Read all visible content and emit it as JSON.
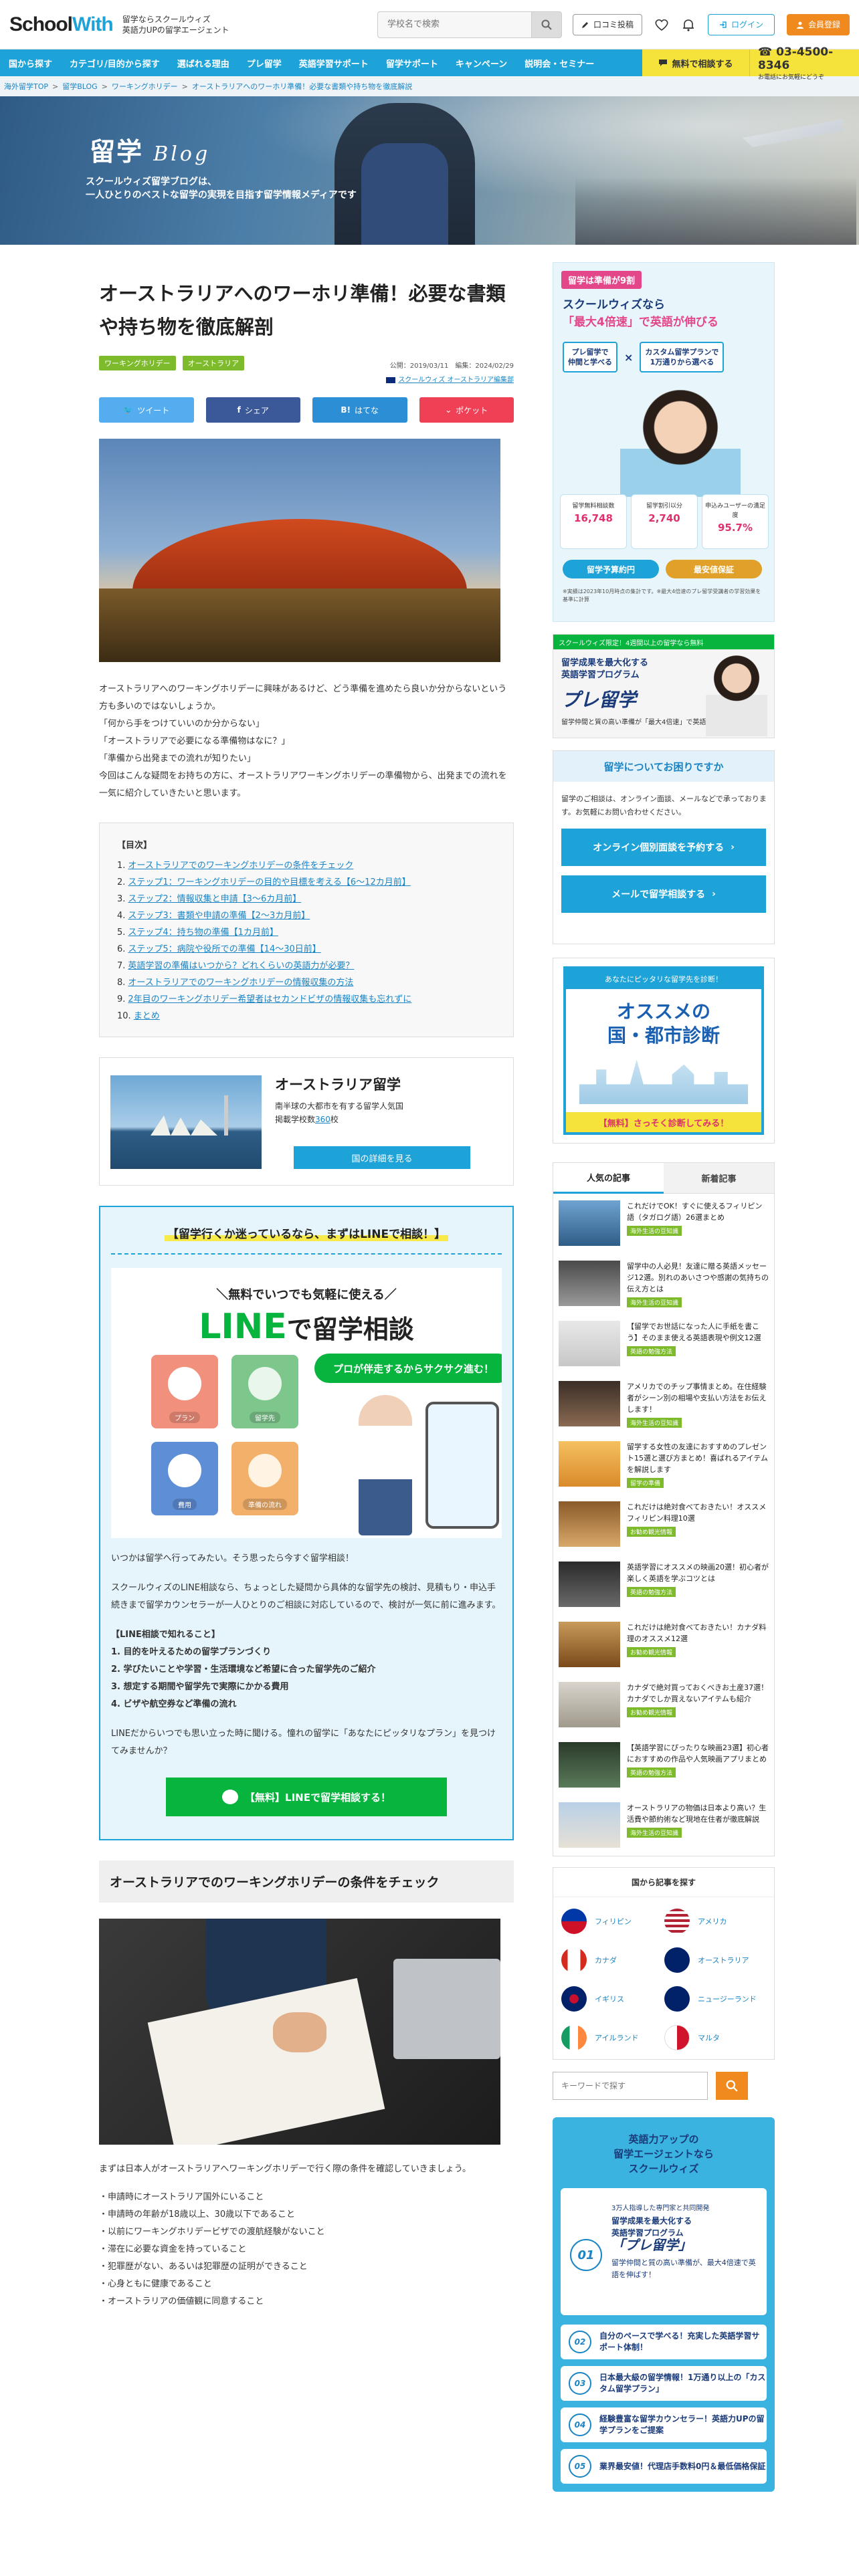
{
  "header": {
    "logo_school": "School",
    "logo_with": "With",
    "tagline_1": "留学ならスクールウィズ",
    "tagline_2": "英語力UPの留学エージェント",
    "search_placeholder": "学校名で検索",
    "review_label": "口コミ投稿",
    "login_label": "ログイン",
    "signup_label": "会員登録"
  },
  "nav": {
    "items": [
      "国から探す",
      "カテゴリ/目的から探す",
      "選ばれる理由",
      "プレ留学",
      "英語学習サポート",
      "留学サポート",
      "キャンペーン",
      "説明会・セミナー"
    ],
    "cta_label": "無料で相談する",
    "tel": "03-4500-8346",
    "tel_sub": "お電話にお気軽にどうぞ"
  },
  "breadcrumb": [
    "海外留学TOP",
    "留学BLOG",
    "ワーキングホリデー",
    "オーストラリアへのワーホリ準備！必要な書類や持ち物を徹底解説"
  ],
  "hero": {
    "title": "留学",
    "title_script": "Blog",
    "desc_1": "スクールウィズ留学ブログは、",
    "desc_2": "一人ひとりのベストな留学の実現を目指す留学情報メディアです"
  },
  "article": {
    "title": "オーストラリアへのワーホリ準備！必要な書類や持ち物を徹底解剖",
    "tags": [
      "ワーキングホリデー",
      "オーストラリア"
    ],
    "published": "公開：2019/03/11",
    "updated": "編集：2024/02/29",
    "author_link": "スクールウィズ オーストラリア編集部",
    "share": {
      "twitter": "ツイート",
      "facebook": "シェア",
      "hatena": "はてな",
      "pocket": "ポケット"
    },
    "intro": [
      "オーストラリアへのワーキングホリデーに興味があるけど、どう準備を進めたら良いか分からないという方も多いのではないしょうか。",
      "「何から手をつけていいのか分からない」",
      "「オーストラリアで必要になる準備物はなに？」",
      "「準備から出発までの流れが知りたい」",
      "今回はこんな疑問をお持ちの方に、オーストラリアワーキングホリデーの準備物から、出発までの流れを一気に紹介していきたいと思います。"
    ],
    "toc_title": "【目次】",
    "toc": [
      "オーストラリアでのワーキングホリデーの条件をチェック",
      "ステップ1：ワーキングホリデーの目的や目標を考える【6〜12カ月前】",
      "ステップ2：情報収集と申請【3〜6カ月前】",
      "ステップ3：書類や申請の準備【2〜3カ月前】",
      "ステップ4：持ち物の準備【1カ月前】",
      "ステップ5：病院や役所での準備【14〜30日前】",
      "英語学習の準備はいつから？どれくらいの英語力が必要？",
      "オーストラリアでのワーキングホリデーの情報収集の方法",
      "2年目のワーキングホリデー希望者はセカンドビザの情報収集も忘れずに",
      "まとめ"
    ],
    "country": {
      "name": "オーストラリア留学",
      "desc": "南半球の大都市を有する留学人気国",
      "count_label": "掲載学校数",
      "count": "360",
      "count_unit": "校",
      "btn": "国の詳細を見る"
    },
    "line": {
      "heading": "【留学行くか迷っているなら、まずはLINEで相談！】",
      "ad_top": "＼無料でいつでも気軽に使える／",
      "ad_line": "LINE",
      "ad_rest": "で留学相談",
      "ad_bubble": "プロが伴走するからサクサク進む！",
      "icons": [
        "プラン",
        "留学先",
        "費用",
        "準備の流れ"
      ],
      "p1": "いつかは留学へ行ってみたい。そう思ったら今すぐ留学相談！",
      "p2": "スクールウィズのLINE相談なら、ちょっとした疑問から具体的な留学先の検討、見積もり・申込手続きまで留学カウンセラーが一人ひとりのご相談に対応しているので、検討が一気に前に進みます。",
      "list_title": "【LINE相談で知れること】",
      "list": [
        "1. 目的を叶えるための留学プランづくり",
        "2. 学びたいことや学習・生活環境など希望に合った留学先のご紹介",
        "3. 想定する期間や留学先で実際にかかる費用",
        "4. ビザや航空券など準備の流れ"
      ],
      "p3": "LINEだからいつでも思い立った時に聞ける。憧れの留学に「あなたにピッタリなプラン」を見つけてみませんか？",
      "btn": "【無料】LINEで留学相談する！"
    },
    "h2": "オーストラリアでのワーキングホリデーの条件をチェック",
    "body2": "まずは日本人がオーストラリアへワーキングホリデーで行く際の条件を確認していきましょう。",
    "conditions": [
      "・申請時にオーストラリア国外にいること",
      "・申請時の年齢が18歳以上、30歳以下であること",
      "・以前にワーキングホリデービザでの渡航経験がないこと",
      "・滞在に必要な資金を持っていること",
      "・犯罪歴がない、あるいは犯罪歴の証明ができること",
      "・心身ともに健康であること",
      "・オーストラリアの価値観に同意すること"
    ]
  },
  "sidebar": {
    "ad1": {
      "pill": "留学は準備が9割",
      "h1": "スクールウィズなら",
      "h2": "「最大4倍速」で英語が伸びる",
      "chip1a": "プレ留学で",
      "chip1b": "仲間と学べる",
      "chip2a": "カスタム留学プランで",
      "chip2b": "1万通りから選べる",
      "stat1": "留学無料相談数",
      "stat1v": "16,748",
      "stat2": "留学割引以分",
      "stat2v": "2,740",
      "stat3": "申込みユーザーの満足度",
      "stat3v": "95.7%",
      "b1": "留学予算約円",
      "b2": "最安値保証",
      "fine": "※実績は2023年10月時点の集計です。※最大4倍速のプレ留学受講者の学習効果を基準に計算"
    },
    "ad2": {
      "bar": "スクールウィズ限定！4週間以上の留学なら無料",
      "t1": "留学成果を最大化する",
      "t2": "英語学習プログラム",
      "big": "プレ留学",
      "sm": "留学仲間と質の高い準備が「最大4倍速」で英語を伸ばす！"
    },
    "consult": {
      "title": "留学についてお困りですか",
      "text": "留学のご相談は、オンライン面談、メールなどで承っております。お気軽にお問い合わせください。",
      "btn1": "オンライン個別面談を予約する",
      "btn2": "メールで留学相談する"
    },
    "diag": {
      "top": "あなたにピッタリな留学先を診断！",
      "big1": "オススメの",
      "big2": "国・都市診断",
      "bot": "【無料】さっそく診断してみる！"
    },
    "popular": {
      "tab1": "人気の記事",
      "tab2": "新着記事",
      "items": [
        {
          "t": "これだけでOK！すぐに使えるフィリピン語（タガログ語）26選まとめ",
          "c": "海外生活の豆知識"
        },
        {
          "t": "留学中の人必見！友達に贈る英語メッセージ12選。別れのあいさつや感謝の気持ちの伝え方とは",
          "c": "海外生活の豆知識"
        },
        {
          "t": "【留学でお世話になった人に手紙を書こう】そのまま使える英語表現や例文12選",
          "c": "英語の勉強方法"
        },
        {
          "t": "アメリカでのチップ事情まとめ。在住経験者がシーン別の相場や支払い方法をお伝えします！",
          "c": "海外生活の豆知識"
        },
        {
          "t": "留学する女性の友達におすすめのプレゼント15選と選び方まとめ！喜ばれるアイテムを解説します",
          "c": "留学の準備"
        },
        {
          "t": "これだけは絶対食べておきたい！オススメフィリピン料理10選",
          "c": "お勧め観光情報"
        },
        {
          "t": "英語学習にオススメの映画20選！初心者が楽しく英語を学ぶコツとは",
          "c": "英語の勉強方法"
        },
        {
          "t": "これだけは絶対食べておきたい！カナダ料理のオススメ12選",
          "c": "お勧め観光情報"
        },
        {
          "t": "カナダで絶対買っておくべきお土産37選！カナダでしか買えないアイテムも紹介",
          "c": "お勧め観光情報"
        },
        {
          "t": "【英語学習にぴったりな映画23選】初心者におすすめの作品や人気映画アプリまとめ",
          "c": "英語の勉強方法"
        },
        {
          "t": "オーストラリアの物価は日本より高い？生活費や節約術など現地在住者が徹底解説",
          "c": "海外生活の豆知識"
        }
      ]
    },
    "bycountry": {
      "title": "国から記事を探す",
      "items": [
        "フィリピン",
        "アメリカ",
        "カナダ",
        "オーストラリア",
        "イギリス",
        "ニュージーランド",
        "アイルランド",
        "マルタ"
      ]
    },
    "keyword_placeholder": "キーワードで探す",
    "ad3": {
      "h1": "英語力アップの",
      "h2": "留学エージェントなら",
      "h3": "スクールウィズ",
      "c1a": "3万人指導した専門家と共同開発",
      "c1b": "留学成果を最大化する",
      "c1c": "英語学習プログラム",
      "c1d": "「プレ留学」",
      "c1e": "留学仲間と質の高い準備が、最大4倍速で英語を伸ばす！",
      "n1": "01",
      "rows": [
        {
          "n": "02",
          "t": "自分のペースで学べる！充実した英語学習サポート体制！"
        },
        {
          "n": "03",
          "t": "日本最大級の留学情報！1万通り以上の「カスタム留学プラン」"
        },
        {
          "n": "04",
          "t": "経験豊富な留学カウンセラー！英語力UPの留学プランをご提案"
        },
        {
          "n": "05",
          "t": "業界最安値！代理店手数料0円＆最低価格保証"
        }
      ]
    }
  }
}
